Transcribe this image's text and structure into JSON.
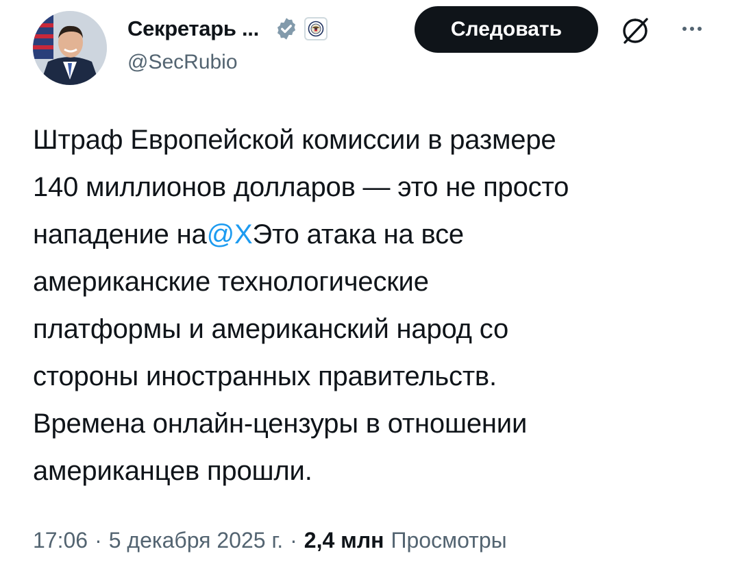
{
  "author": {
    "display_name": "Секретарь ...",
    "handle": "@SecRubio",
    "avatar_icon": "profile-photo-icon",
    "verified_icon": "verified-badge-icon",
    "affiliation_icon": "state-department-seal-icon",
    "verified_color": "#829aab"
  },
  "actions": {
    "follow_label": "Следовать",
    "grok_icon": "grok-icon",
    "more_icon": "more-options-icon"
  },
  "tweet": {
    "line1": "Штраф Европейской комиссии в размере",
    "line2": "140 миллионов долларов — это не просто",
    "line3_before": "нападение на",
    "mention": "@X",
    "line3_after": "Это атака на все",
    "line4": "американские технологические",
    "line5": "платформы и американский народ со",
    "line6": "стороны иностранных правительств.",
    "line7": "Времена онлайн-цензуры в отношении",
    "line8": "американцев прошли.",
    "mention_color": "#1d9bf0"
  },
  "meta": {
    "time": "17:06",
    "separator": "·",
    "date": "5 декабря 2025 г.",
    "views_count": "2,4 млн",
    "views_label": "Просмотры"
  }
}
